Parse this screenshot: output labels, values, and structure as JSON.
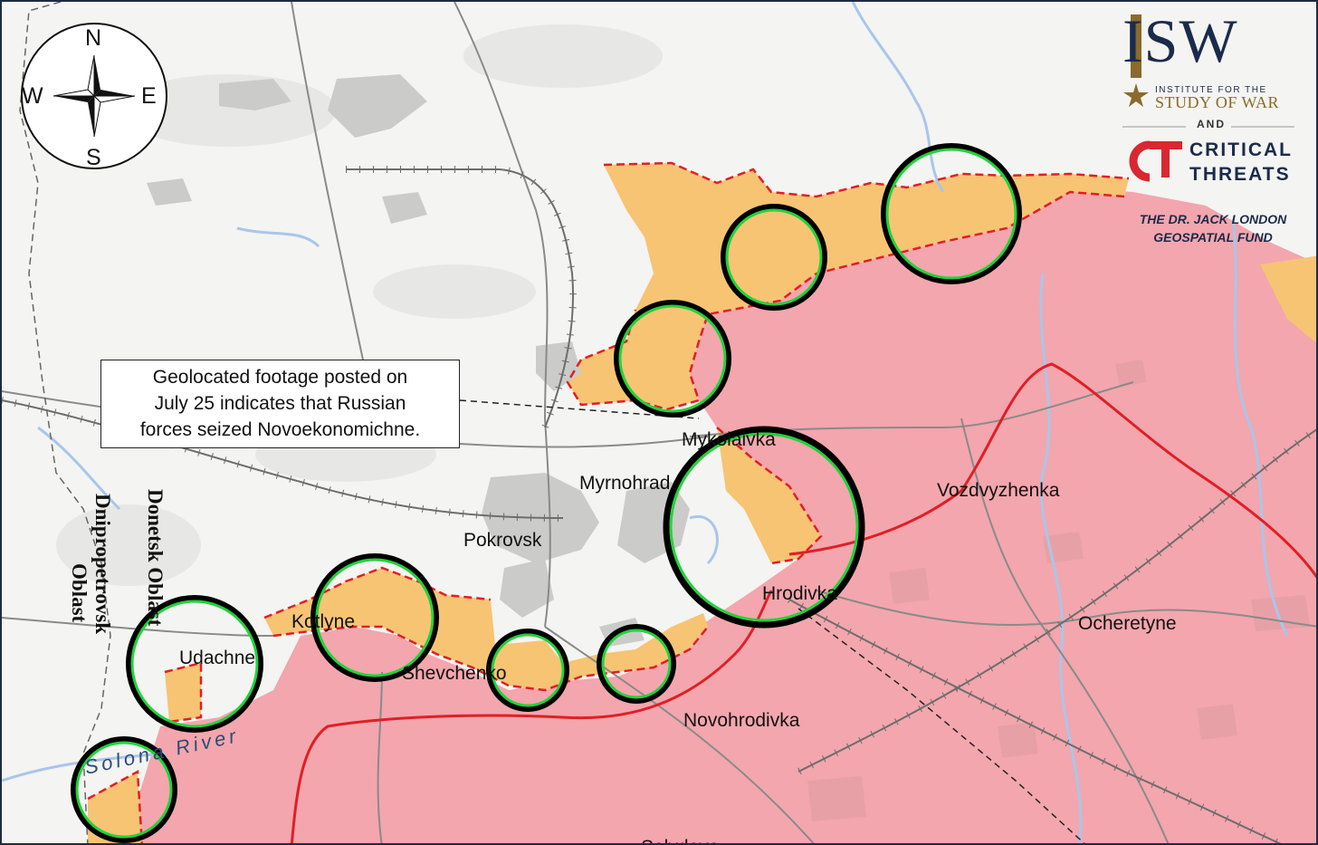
{
  "map": {
    "colors": {
      "russian_control": "#f3a6ad",
      "russian_advance": "#f7c474",
      "front_line": "#e01f26",
      "highlight_circle": "#22d33a",
      "background": "#f4f4f2",
      "urban": "#c9c9c9",
      "rivers": "#a9c6ea"
    },
    "compass": {
      "n": "N",
      "s": "S",
      "e": "E",
      "w": "W"
    },
    "callout": {
      "line1": "Geolocated footage posted on",
      "line2": "July 25 indicates that Russian",
      "line3": "forces seized Novoekonomichne."
    },
    "places": {
      "mykolaivka": "Mykolaivka",
      "myrnohrad": "Myrnohrad",
      "pokrovsk": "Pokrovsk",
      "vozdvyzhenka": "Vozdvyzhenka",
      "hrodivka": "Hrodivka",
      "ocheretyne": "Ocheretyne",
      "kotlyne": "Kotlyne",
      "udachne": "Udachne",
      "shevchenko": "Shevchenko",
      "novohrodivka": "Novohrodivka",
      "selydove": "Selydove"
    },
    "river": "Solona River",
    "oblasts": {
      "donetsk": "Donetsk Oblast",
      "dnipro_line1": "Dnipropetrovsk",
      "dnipro_line2": "Oblast"
    },
    "logos": {
      "isw": "ISW",
      "isw_sub1": "INSTITUTE FOR THE",
      "isw_sub2": "STUDY OF WAR",
      "and": "AND",
      "ct_line1": "CRITICAL",
      "ct_line2": "THREATS",
      "fund_line1": "THE DR. JACK LONDON",
      "fund_line2": "GEOSPATIAL FUND"
    }
  }
}
